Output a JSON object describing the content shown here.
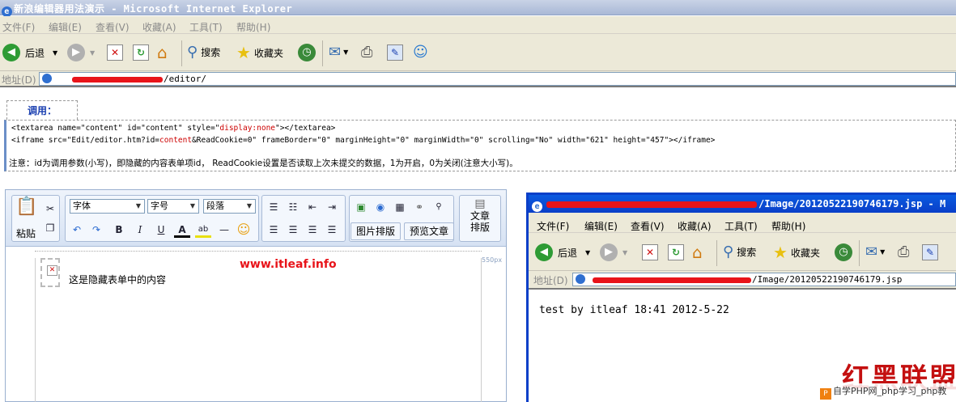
{
  "window": {
    "title": "新浪编辑器用法演示 - Microsoft Internet Explorer"
  },
  "menu": [
    "文件(F)",
    "编辑(E)",
    "查看(V)",
    "收藏(A)",
    "工具(T)",
    "帮助(H)"
  ],
  "toolbar": {
    "back_label": "后退",
    "search_label": "搜索",
    "favorites_label": "收藏夹"
  },
  "address": {
    "label": "地址(D)",
    "url_suffix": "/editor/"
  },
  "call": {
    "tab_label": "调用：",
    "code_line1_a": "<textarea name=\"content\" id=\"content\" style=\"",
    "code_line1_red": "display:none",
    "code_line1_b": "\"></textarea>",
    "code_line2_a": "<iframe src=\"Edit/editor.htm?id=",
    "code_line2_red": "content",
    "code_line2_b": "&ReadCookie=0\" frameBorder=\"0\" marginHeight=\"0\" marginWidth=\"0\" scrolling=\"No\" width=\"621\" height=\"457\"></iframe>",
    "note": "注意：id为调用参数(小写)，即隐藏的内容表单项id， ReadCookie设置是否读取上次未提交的数据，1为开启，0为关闭(注意大小写)。"
  },
  "editor": {
    "paste_label": "粘贴",
    "font_select": "字体",
    "size_select": "字号",
    "para_select": "段落",
    "image_layout_button": "图片排版",
    "preview_button": "预览文章",
    "article_layout_l1": "文章",
    "article_layout_l2": "排版",
    "ruler_label": "550px",
    "hidden_content": "这是隐藏表单中的内容",
    "site_text": "www.itleaf.info"
  },
  "popup": {
    "title_suffix": "/Image/20120522190746179.jsp - M",
    "menu": [
      "文件(F)",
      "编辑(E)",
      "查看(V)",
      "收藏(A)",
      "工具(T)",
      "帮助(H)"
    ],
    "back_label": "后退",
    "search_label": "搜索",
    "favorites_label": "收藏夹",
    "address_label": "地址(D)",
    "url_suffix": "/Image/20120522190746179.jsp",
    "page_text": "test by itleaf 18:41 2012-5-22"
  },
  "watermark": {
    "big": "红黑联盟",
    "small": "自学PHP网_php学习_php教"
  },
  "colors": {
    "accent_red": "#e8141a",
    "title_blue": "#0a3fc8",
    "code_red": "#cc0000"
  }
}
